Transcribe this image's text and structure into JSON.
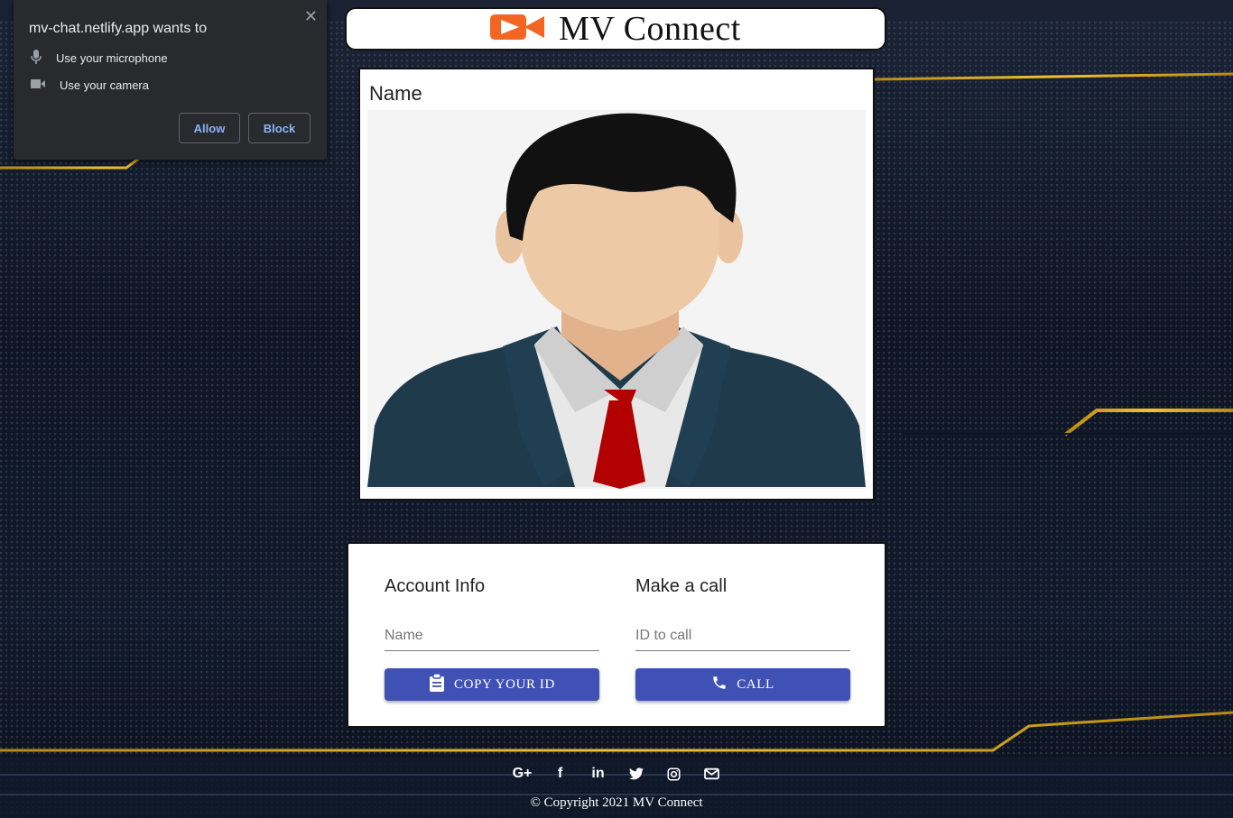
{
  "permission_prompt": {
    "title": "mv-chat.netlify.app wants to",
    "items": [
      {
        "icon": "microphone-icon",
        "label": "Use your microphone"
      },
      {
        "icon": "camera-icon",
        "label": "Use your camera"
      }
    ],
    "allow_label": "Allow",
    "block_label": "Block",
    "close_glyph": "✕"
  },
  "header": {
    "title": "MV Connect",
    "logo_icon": "video-camera-icon",
    "logo_color": "#f26522"
  },
  "video": {
    "name_label": "Name",
    "avatar_icon": "businessman-avatar-icon"
  },
  "options": {
    "account_info": {
      "heading": "Account Info",
      "name_placeholder": "Name",
      "name_value": "",
      "copy_button": "COPY YOUR ID",
      "copy_icon": "clipboard-icon"
    },
    "make_call": {
      "heading": "Make a call",
      "id_placeholder": "ID to call",
      "id_value": "",
      "call_button": "CALL",
      "call_icon": "phone-icon"
    },
    "button_color": "#3f51b5"
  },
  "footer": {
    "social": [
      {
        "name": "google-plus-icon",
        "glyph": "G+"
      },
      {
        "name": "facebook-icon",
        "glyph": "f"
      },
      {
        "name": "linkedin-icon",
        "glyph": "in"
      },
      {
        "name": "twitter-icon",
        "glyph": "🐦"
      },
      {
        "name": "instagram-icon",
        "glyph": "◎"
      },
      {
        "name": "email-icon",
        "glyph": "✉"
      }
    ],
    "copyright": "© Copyright 2021 MV Connect"
  },
  "colors": {
    "background": "#121a2b",
    "gold_accent": "#e0a818"
  }
}
